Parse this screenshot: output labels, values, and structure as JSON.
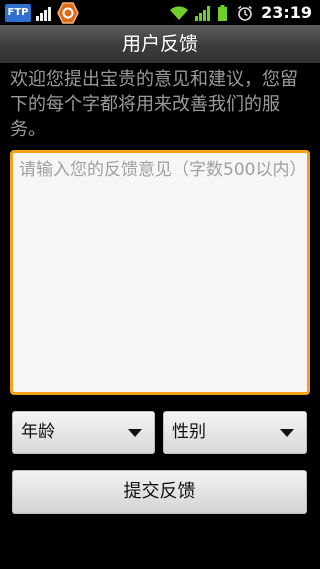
{
  "status_bar": {
    "ftp_label": "FTP",
    "time": "23:19",
    "icons": [
      "ftp-icon",
      "signal-small-icon",
      "notification-app-icon",
      "wifi-icon",
      "cell-signal-icon",
      "battery-icon",
      "alarm-icon"
    ],
    "accent_signal_color": "#6fd02a"
  },
  "header": {
    "title": "用户反馈"
  },
  "intro": {
    "text": "欢迎您提出宝贵的意见和建议，您留下的每个字都将用来改善我们的服务。"
  },
  "feedback": {
    "placeholder": "请输入您的反馈意见（字数500以内）",
    "value": "",
    "border_color": "#f5a21b"
  },
  "filters": {
    "age_label": "年龄",
    "gender_label": "性别"
  },
  "submit": {
    "label": "提交反馈"
  }
}
